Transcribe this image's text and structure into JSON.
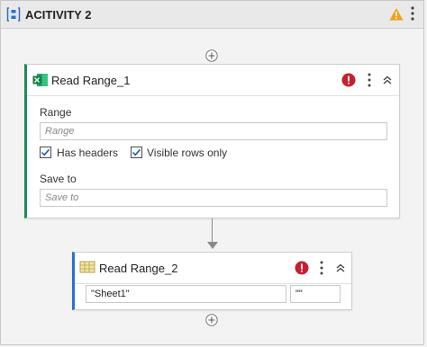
{
  "sequence": {
    "title": "ACITIVITY 2"
  },
  "activities": [
    {
      "title": "Read Range_1",
      "range_label": "Range",
      "range_placeholder": "Range",
      "has_headers_label": "Has headers",
      "has_headers_checked": true,
      "visible_rows_label": "Visible rows only",
      "visible_rows_checked": true,
      "save_to_label": "Save to",
      "save_to_placeholder": "Save to",
      "accent_color": "#1e8a5a"
    },
    {
      "title": "Read Range_2",
      "sheet_value": "\"Sheet1\"",
      "range_value": "\"\"",
      "accent_color": "#2a6fd0"
    }
  ],
  "icons": {
    "sequence": "sequence-icon",
    "warning": "warning-icon",
    "error": "error-icon",
    "more": "more-options-icon",
    "collapse": "collapse-icon",
    "add": "add-activity-icon",
    "excel": "excel-icon",
    "workbook": "workbook-icon"
  }
}
